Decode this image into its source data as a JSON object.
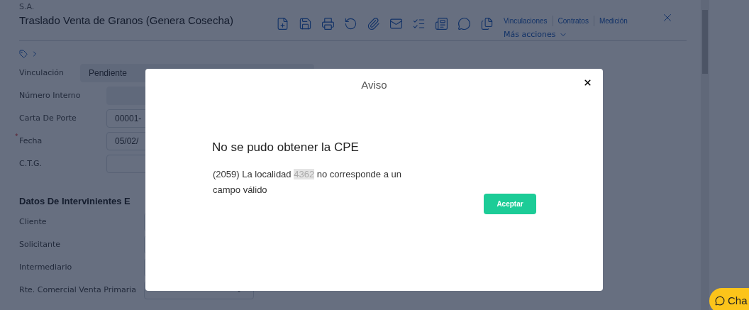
{
  "header": {
    "company": "S.A.",
    "title": "Traslado Venta de Granos (Genera Cosecha)",
    "links": [
      "Vinculaciones",
      "Contratos",
      "Medición"
    ],
    "more_actions": "Más acciones"
  },
  "form": {
    "fields": [
      {
        "label": "Vinculación",
        "value": "Pendiente",
        "kind": "readonly"
      },
      {
        "label": "Número Interno",
        "kind": "readonly"
      },
      {
        "label": "Carta De Porte",
        "value": "00001-",
        "kind": "input"
      },
      {
        "label": "Fecha",
        "value": "05/02/",
        "kind": "input",
        "required_mark": "*"
      },
      {
        "label": "C.T.G.",
        "kind": "input"
      }
    ],
    "section_title": "Datos De Intervinientes E",
    "party_fields": [
      {
        "label": "Cliente",
        "kind": "input"
      },
      {
        "label": "Solicitante",
        "kind": "input"
      },
      {
        "label": "Intermediario",
        "kind": "input"
      },
      {
        "label": "Rte. Comercial Venta Primaria",
        "kind": "select"
      }
    ]
  },
  "dialog": {
    "title": "Aviso",
    "heading": "No se pudo obtener la CPE",
    "message_before": "(2059) La localidad ",
    "masked_value": "4362",
    "message_after": " no corresponde a un campo válido",
    "button": "Aceptar"
  },
  "chat": {
    "label": "Cha"
  }
}
